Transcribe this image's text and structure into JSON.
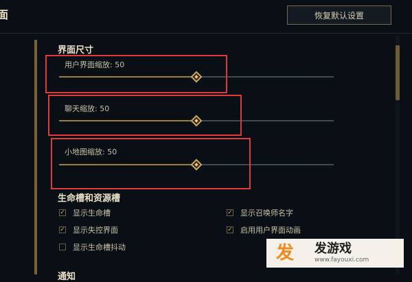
{
  "window": {
    "title": "面"
  },
  "toolbar": {
    "reset_label": "恢复默认设置"
  },
  "sections": {
    "interface_size": {
      "title": "界面尺寸",
      "sliders": [
        {
          "label": "用户界面缩放: 50",
          "value": 50
        },
        {
          "label": "聊天缩放: 50",
          "value": 50
        },
        {
          "label": "小地图缩放: 50",
          "value": 50
        }
      ]
    },
    "health_bars": {
      "title": "生命槽和资源槽",
      "options": [
        {
          "label": "显示生命槽",
          "checked": true
        },
        {
          "label": "显示召唤师名字",
          "checked": true
        },
        {
          "label": "显示失控界面",
          "checked": true
        },
        {
          "label": "启用用户界面动画",
          "checked": true
        },
        {
          "label": "显示生命槽抖动",
          "checked": false
        }
      ]
    },
    "notifications": {
      "title": "通知"
    }
  },
  "watermark": {
    "brand_main": "发游戏",
    "url": "www.fayouxi.com"
  },
  "colors": {
    "accent_gold": "#c9a85a",
    "highlight_red": "#e03a3a",
    "background": "#0a0f16"
  }
}
